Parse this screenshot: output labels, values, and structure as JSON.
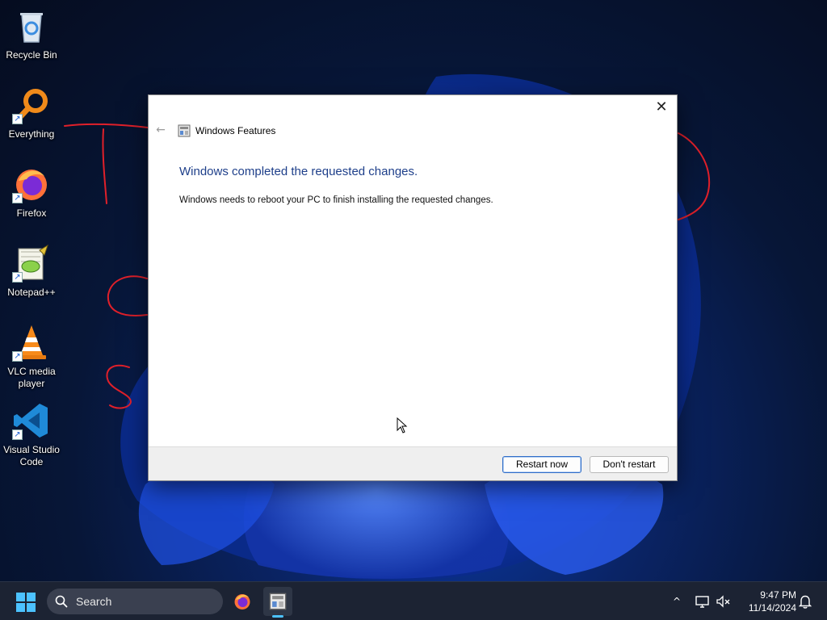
{
  "desktop": {
    "icons": [
      {
        "label": "Recycle Bin",
        "icon": "recycle-bin-icon"
      },
      {
        "label": "Everything",
        "icon": "everything-search-icon"
      },
      {
        "label": "Firefox",
        "icon": "firefox-icon"
      },
      {
        "label": "Notepad++",
        "icon": "notepad-plus-plus-icon"
      },
      {
        "label": "VLC media player",
        "icon": "vlc-cone-icon"
      },
      {
        "label": "Visual Studio Code",
        "icon": "vscode-icon"
      }
    ],
    "scribble_color": "#e0202a"
  },
  "dialog": {
    "title": "Windows Features",
    "heading": "Windows completed the requested changes.",
    "message": "Windows needs to reboot your PC to finish installing the requested changes.",
    "buttons": {
      "restart_now": "Restart now",
      "dont_restart": "Don't restart"
    },
    "close_glyph": "✕",
    "back_glyph": "←",
    "heading_color": "#1e3f8a"
  },
  "taskbar": {
    "search_placeholder": "Search",
    "apps": [
      {
        "name": "Firefox",
        "icon": "firefox-icon",
        "active": false
      },
      {
        "name": "Windows Features",
        "icon": "windows-features-icon",
        "active": true
      }
    ],
    "tray": {
      "chevron": "^",
      "time": "9:47 PM",
      "date": "11/14/2024"
    },
    "accent": "#4cc2ff"
  }
}
